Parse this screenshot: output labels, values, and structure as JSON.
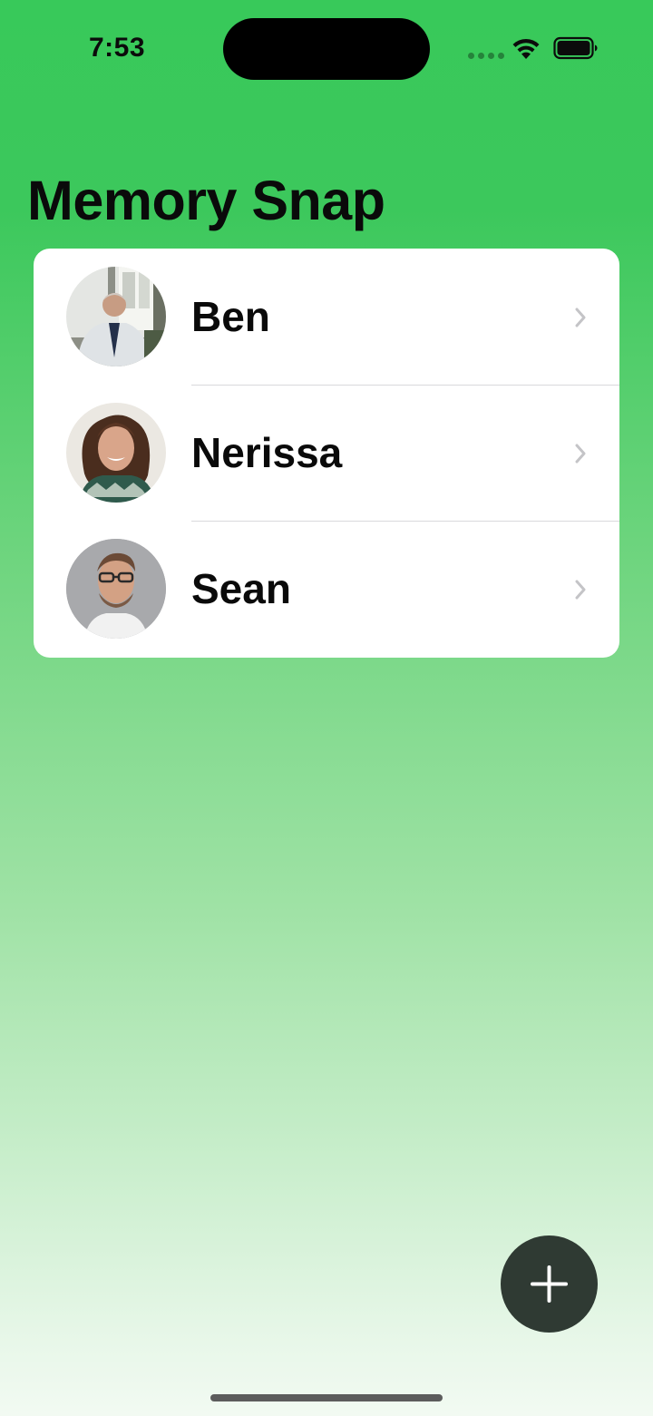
{
  "status_bar": {
    "time": "7:53",
    "icons": [
      "cellular-signal-icon",
      "wifi-icon",
      "battery-icon"
    ]
  },
  "header": {
    "title": "Memory Snap"
  },
  "people": [
    {
      "name": "Ben",
      "avatar": "person-photo-avatar",
      "accessory": "chevron-right-icon"
    },
    {
      "name": "Nerissa",
      "avatar": "person-photo-avatar",
      "accessory": "chevron-right-icon"
    },
    {
      "name": "Sean",
      "avatar": "person-photo-avatar",
      "accessory": "chevron-right-icon"
    }
  ],
  "fab": {
    "icon": "plus-icon"
  },
  "colors": {
    "background_top": "#38c95a",
    "background_bottom": "#f2faf2",
    "card": "#ffffff",
    "fab": "#2f3a33",
    "chevron": "#c4c4c7"
  }
}
